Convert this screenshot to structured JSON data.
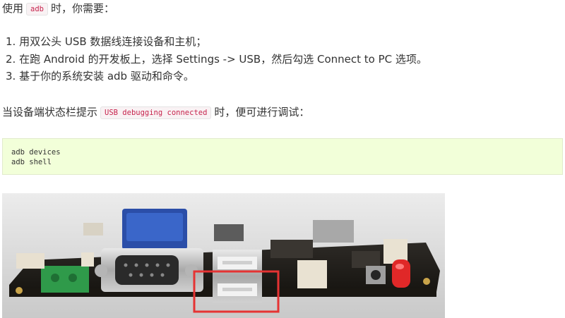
{
  "intro": {
    "before": "使用",
    "code": "adb",
    "after": "时，你需要："
  },
  "steps": [
    "1. 用双公头 USB 数据线连接设备和主机；",
    "2. 在跑 Android 的开发板上，选择 Settings -> USB，然后勾选 Connect to PC 选项。",
    "3. 基于你的系统安装 adb 驱动和命令。"
  ],
  "status": {
    "before": "当设备端状态栏提示",
    "code": "USB debugging connected",
    "after": "时，便可进行调试："
  },
  "code_block": {
    "line1": "adb devices",
    "line2": "adb shell"
  },
  "photo": {
    "highlight_color": "#e53333"
  }
}
